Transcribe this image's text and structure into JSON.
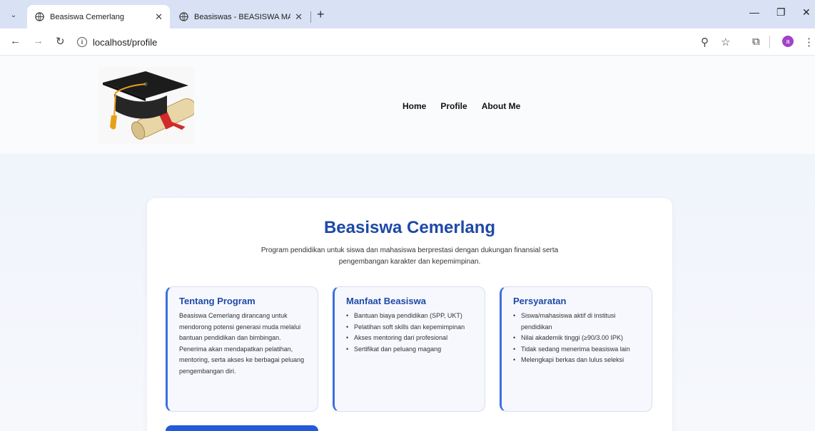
{
  "browser": {
    "tabs": [
      {
        "title": "Beasiswa Cemerlang",
        "active": true
      },
      {
        "title": "Beasiswas - BEASISWA MAHAS",
        "active": false
      }
    ],
    "url": "localhost/profile",
    "profile_initial": "a",
    "colors": {
      "tabbar": "#d9e2f5",
      "avatar": "#a142c8"
    }
  },
  "site": {
    "nav": [
      "Home",
      "Profile",
      "About Me"
    ]
  },
  "main": {
    "title": "Beasiswa Cemerlang",
    "description": "Program pendidikan untuk siswa dan mahasiswa berprestasi dengan dukungan finansial serta pengembangan karakter dan kepemimpinan.",
    "about": {
      "heading": "Tentang Program",
      "text": "Beasiswa Cemerlang dirancang untuk mendorong potensi generasi muda melalui bantuan pendidikan dan bimbingan. Penerima akan mendapatkan pelatihan, mentoring, serta akses ke berbagai peluang pengembangan diri."
    },
    "benefits": {
      "heading": "Manfaat Beasiswa",
      "items": [
        "Bantuan biaya pendidikan (SPP, UKT)",
        "Pelatihan soft skills dan kepemimpinan",
        "Akses mentoring dari profesional",
        "Sertifikat dan peluang magang"
      ]
    },
    "requirements": {
      "heading": "Persyaratan",
      "items": [
        "Siswa/mahasiswa aktif di institusi pendidikan",
        "Nilai akademik tinggi (≥90/3.00 IPK)",
        "Tidak sedang menerima beasiswa lain",
        "Melengkapi berkas dan lulus seleksi"
      ]
    },
    "colors": {
      "accent": "#1e49a8",
      "border_accent": "#3b6fe0",
      "cta": "#2559d8"
    }
  }
}
